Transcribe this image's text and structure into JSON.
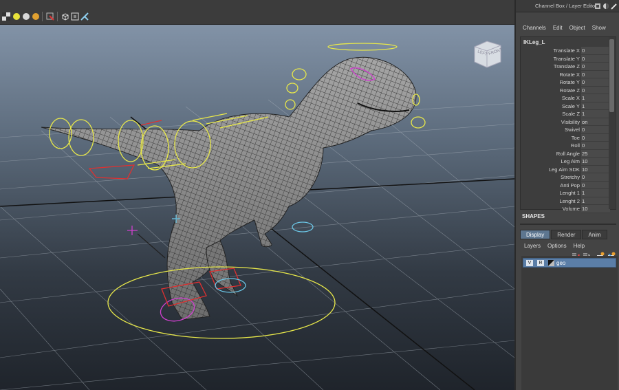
{
  "panel": {
    "title": "Channel Box / Layer Editor",
    "menu": [
      "Channels",
      "Edit",
      "Object",
      "Show"
    ]
  },
  "channel_box": {
    "node": "IKLeg_L",
    "attributes": [
      {
        "label": "Translate X",
        "value": "0"
      },
      {
        "label": "Translate Y",
        "value": "0"
      },
      {
        "label": "Translate Z",
        "value": "0"
      },
      {
        "label": "Rotate X",
        "value": "0"
      },
      {
        "label": "Rotate Y",
        "value": "0"
      },
      {
        "label": "Rotate Z",
        "value": "0"
      },
      {
        "label": "Scale X",
        "value": "1"
      },
      {
        "label": "Scale Y",
        "value": "1"
      },
      {
        "label": "Scale Z",
        "value": "1"
      },
      {
        "label": "Visibility",
        "value": "on"
      },
      {
        "label": "Swivel",
        "value": "0"
      },
      {
        "label": "Toe",
        "value": "0"
      },
      {
        "label": "Roll",
        "value": "0"
      },
      {
        "label": "Roll Angle",
        "value": "25"
      },
      {
        "label": "Leg Aim",
        "value": "10"
      },
      {
        "label": "Leg Aim SDK",
        "value": "10"
      },
      {
        "label": "Stretchy",
        "value": "0"
      },
      {
        "label": "Anti Pop",
        "value": "0"
      },
      {
        "label": "Lenght 1",
        "value": "1"
      },
      {
        "label": "Lenght 2",
        "value": "1"
      },
      {
        "label": "Volume",
        "value": "10"
      }
    ],
    "shapes_label": "SHAPES"
  },
  "layer_editor": {
    "tabs": [
      "Display",
      "Render",
      "Anim"
    ],
    "active_tab": "Display",
    "menu": [
      "Layers",
      "Options",
      "Help"
    ],
    "layer": {
      "visible": "V",
      "reference": "R",
      "name": "geo"
    }
  },
  "view_cube": {
    "left_face": "LEFT",
    "front_face": "FRONT"
  },
  "colors": {
    "accent": "#5d7690",
    "layer_highlight": "#5b7ea7",
    "control_yellow": "#e8e84a",
    "control_magenta": "#d040d0",
    "control_red": "#e03030"
  }
}
